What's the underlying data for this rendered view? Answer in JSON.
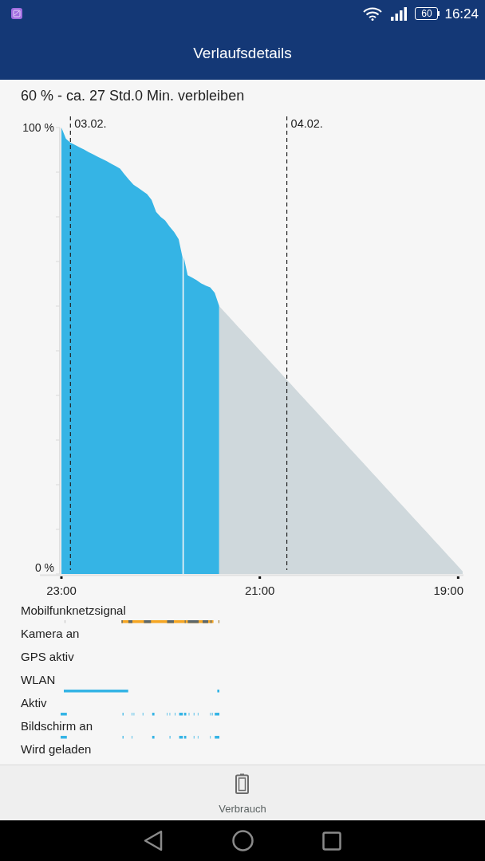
{
  "status_bar": {
    "battery": "60",
    "time": "16:24"
  },
  "header": {
    "title": "Verlaufsdetails"
  },
  "summary": "60 % - ca. 27 Std.0 Min. verbleiben",
  "chart": {
    "chart_data": {
      "type": "area",
      "categories": [
        "23:00",
        null,
        null,
        null,
        null,
        null,
        null,
        null,
        null,
        null,
        null,
        null,
        null,
        null,
        null,
        null,
        null,
        null,
        null,
        null,
        null,
        null,
        null,
        null,
        null,
        null,
        null,
        null,
        null,
        null,
        null,
        null,
        null,
        null,
        null,
        null,
        null,
        null,
        null,
        null,
        null,
        null,
        null,
        null,
        "21:00",
        null,
        null,
        null,
        null,
        null,
        null,
        null,
        null,
        null,
        null,
        null,
        null,
        null,
        null,
        null,
        null,
        null,
        null,
        null,
        null,
        null,
        null,
        null,
        null,
        null,
        null,
        null,
        null,
        null,
        null,
        null,
        null,
        null,
        null,
        null,
        null,
        null,
        null,
        null,
        null,
        null,
        null,
        null,
        "19:00",
        null
      ],
      "series": [
        {
          "color": "#35b4e5",
          "values": [
            100,
            97.5,
            96.6,
            96.1,
            95.6,
            95.1,
            94.5,
            94,
            93.5,
            93,
            92.5,
            91.9,
            91.4,
            90.8,
            89.5,
            88.3,
            87.2,
            86.5,
            85.8,
            85.1,
            83.8,
            81.1,
            80,
            79.2,
            77.8,
            76.6,
            75,
            null,
            66.9,
            66.4,
            65.8,
            65.1,
            64.6,
            64.2,
            63,
            60,
            null,
            null,
            null,
            null,
            null,
            null,
            null,
            null,
            null,
            null,
            null,
            null,
            null,
            null,
            null,
            null,
            null,
            null,
            null,
            null,
            null,
            null,
            null,
            null,
            null,
            null,
            null,
            null,
            null,
            null,
            null,
            null,
            null,
            null,
            null,
            null,
            null,
            null,
            null,
            null,
            null,
            null,
            null,
            null,
            null,
            null,
            null,
            null,
            null,
            null,
            null,
            null,
            null,
            null
          ]
        },
        {
          "color": "#cfd8dc",
          "values": [
            null,
            null,
            null,
            null,
            null,
            null,
            null,
            null,
            null,
            null,
            null,
            null,
            null,
            null,
            null,
            null,
            null,
            null,
            null,
            null,
            null,
            null,
            null,
            null,
            null,
            null,
            null,
            null,
            null,
            null,
            null,
            null,
            null,
            null,
            null,
            60,
            58.9,
            57.8,
            56.7,
            55.6,
            54.5,
            53.4,
            52.3,
            51.2,
            50.1,
            49,
            47.9,
            46.8,
            45.7,
            44.6,
            43.5,
            42.4,
            41.3,
            40.2,
            39.1,
            38,
            36.9,
            35.8,
            34.7,
            33.6,
            32.5,
            31.4,
            30.3,
            29.2,
            28.1,
            27,
            25.9,
            24.8,
            23.7,
            22.6,
            21.5,
            20.4,
            19.3,
            18.2,
            17.1,
            16,
            14.9,
            13.8,
            12.7,
            11.6,
            10.5,
            9.4,
            8.3,
            7.2,
            6.1,
            5,
            3.9,
            2.8,
            1.7,
            0.6
          ]
        }
      ],
      "ylim": [
        0,
        100
      ],
      "yticks": [
        {
          "value": 0,
          "label": "0 %"
        },
        {
          "value": 100,
          "label": "100 %"
        }
      ],
      "annotations": [
        "03.02.",
        "04.02."
      ]
    }
  },
  "activity_rows": [
    {
      "label": "Mobilfunknetzsignal",
      "kind": "signal"
    },
    {
      "label": "Kamera an",
      "kind": "none"
    },
    {
      "label": "GPS aktiv",
      "kind": "none"
    },
    {
      "label": "WLAN",
      "kind": "wifi"
    },
    {
      "label": "Aktiv",
      "kind": "awake"
    },
    {
      "label": "Bildschirm an",
      "kind": "screen"
    },
    {
      "label": "Wird geladen",
      "kind": "none"
    }
  ],
  "bottom_bar": {
    "items": [
      {
        "label": "Verbrauch"
      }
    ]
  }
}
